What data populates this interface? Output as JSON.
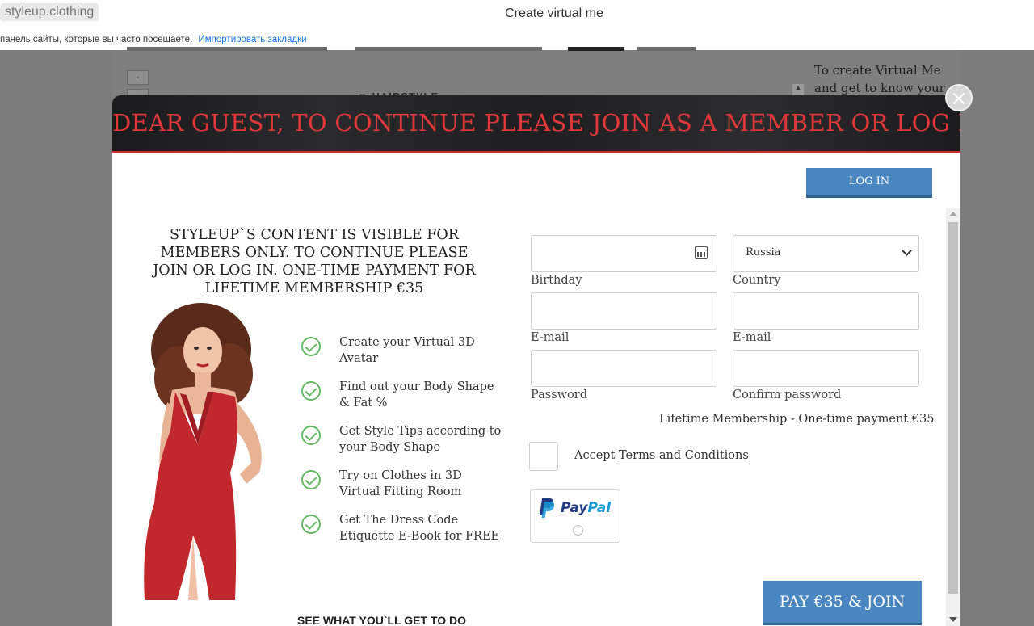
{
  "browser": {
    "domain": "styleup.clothing",
    "page_title": "Create virtual me",
    "bookmarks_hint": "панель сайты, которые вы часто посещаете.",
    "import_bookmarks_link": "Импортировать закладки"
  },
  "background": {
    "minus_btn": "-",
    "plus_btn": "+",
    "hairstyle_label": "HAIRSTYLE",
    "side_text": "To create Virtual Me and get to know your"
  },
  "modal": {
    "title": "DEAR GUEST, TO CONTINUE PLEASE JOIN AS A MEMBER OR LOG IN",
    "close_symbol": "×",
    "login_label": "LOG IN",
    "intro_text": "STYLEUP`S CONTENT IS VISIBLE FOR MEMBERS ONLY. TO CONTINUE PLEASE JOIN OR LOG IN. ONE-TIME PAYMENT FOR LIFETIME MEMBERSHIP €35",
    "features": [
      "Create your Virtual 3D Avatar",
      "Find out your Body Shape & Fat %",
      "Get Style Tips according to your Body Shape",
      "Try on Clothes in 3D Virtual Fitting Room",
      "Get The Dress Code Etiquette E-Book for FREE"
    ],
    "see_what": "SEE WHAT YOU`LL GET TO DO",
    "form": {
      "birthday_label": "Birthday",
      "country_label": "Country",
      "country_value": "Russia",
      "email_label": "E-mail",
      "email_confirm_label": "E-mail",
      "password_label": "Password",
      "confirm_password_label": "Confirm password",
      "lifetime_text": "Lifetime Membership - One-time payment €35",
      "accept_text": "Accept",
      "terms_link": "Terms and Conditions",
      "paypal_pay": "Pay",
      "paypal_pal": "Pal"
    },
    "pay_button": "PAY €35 & JOIN"
  },
  "colors": {
    "accent_red": "#e0383a",
    "button_blue": "#4a86bf",
    "check_green": "#67b967",
    "overlay_gray": "#7c7c7c"
  },
  "icons": [
    "calendar-icon",
    "chevron-down-icon",
    "check-icon",
    "close-icon",
    "paypal-logo"
  ]
}
